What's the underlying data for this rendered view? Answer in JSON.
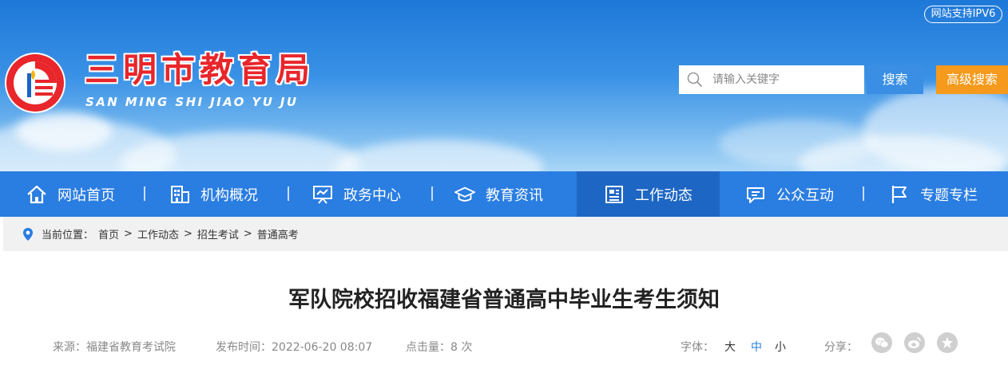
{
  "header": {
    "ipv6_badge": "网站支持IPV6",
    "site_title": "三明市教育局",
    "site_pinyin": "SAN MING SHI JIAO YU JU",
    "search": {
      "placeholder": "请输入关键字",
      "value": ""
    },
    "search_button": "搜索",
    "advanced_search_button": "高级搜索"
  },
  "nav": {
    "items": [
      {
        "label": "网站首页",
        "icon": "home-icon"
      },
      {
        "label": "机构概况",
        "icon": "building-icon"
      },
      {
        "label": "政务中心",
        "icon": "presentation-icon"
      },
      {
        "label": "教育资讯",
        "icon": "graduation-cap-icon"
      },
      {
        "label": "工作动态",
        "icon": "news-icon",
        "active": true
      },
      {
        "label": "公众互动",
        "icon": "chat-icon"
      },
      {
        "label": "专题专栏",
        "icon": "flag-icon"
      }
    ]
  },
  "breadcrumb": {
    "prefix": "当前位置：",
    "separator": ">",
    "items": [
      "首页",
      "工作动态",
      "招生考试",
      "普通高考"
    ]
  },
  "article": {
    "title": "军队院校招收福建省普通高中毕业生考生须知",
    "source_label": "来源：",
    "source": "福建省教育考试院",
    "publish_label": "发布时间：",
    "publish_time": "2022-06-20 08:07",
    "hits_label": "点击量：",
    "hits": "8 次",
    "font_label": "字体：",
    "font_sizes": [
      "大",
      "中",
      "小"
    ],
    "share_label": "分享：",
    "share_icons": [
      "wechat-icon",
      "weibo-icon",
      "favorite-icon"
    ]
  },
  "colors": {
    "nav_bg": "#2a7de1",
    "nav_active": "#1e66c4",
    "title_red": "#e8262b",
    "advanced_search": "#f59a1c",
    "search_button": "#3a8fe4"
  }
}
